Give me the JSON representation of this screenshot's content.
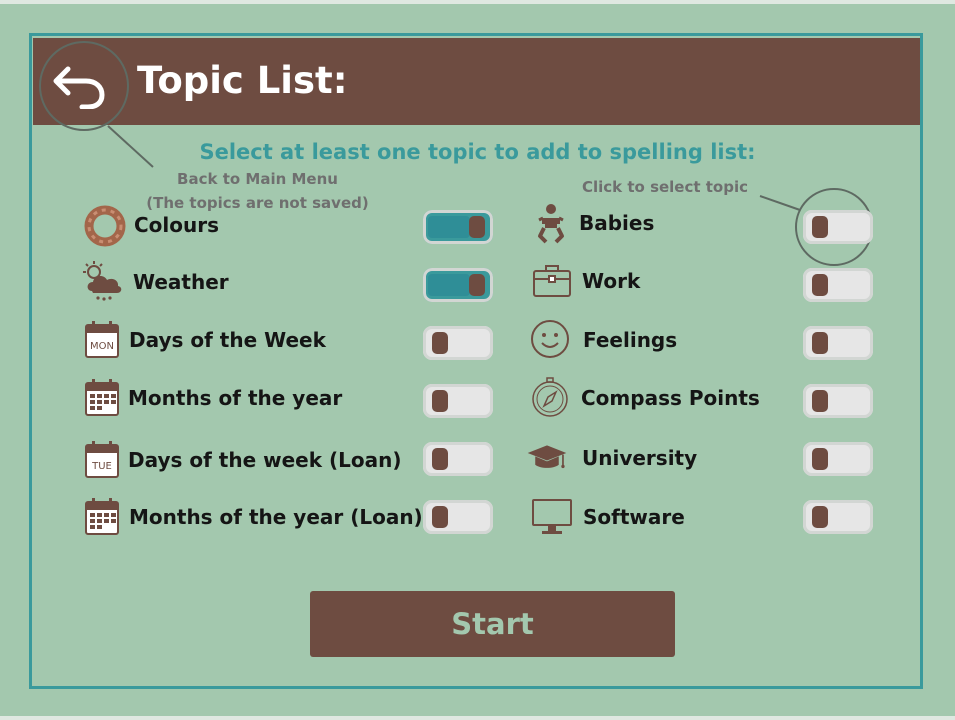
{
  "header": {
    "title": "Topic List:"
  },
  "instruction": "Select at least one topic to add to spelling list:",
  "notes": {
    "back_line1": "Back to Main Menu",
    "back_line2": "(The topics are not saved)",
    "click_hint": "Click to select topic"
  },
  "topics_left": [
    {
      "label": "Colours",
      "icon": "colours-ring-icon",
      "selected": true
    },
    {
      "label": "Weather",
      "icon": "weather-cloud-icon",
      "selected": true
    },
    {
      "label": "Days of the Week",
      "icon": "calendar-mon-icon",
      "icon_text": "MON",
      "selected": false
    },
    {
      "label": "Months of the year",
      "icon": "calendar-grid-icon",
      "selected": false
    },
    {
      "label": "Days of the week (Loan)",
      "icon": "calendar-tue-icon",
      "icon_text": "TUE",
      "selected": false
    },
    {
      "label": "Months of the year (Loan)",
      "icon": "calendar-grid-icon",
      "selected": false
    }
  ],
  "topics_right": [
    {
      "label": "Babies",
      "icon": "baby-icon",
      "selected": false
    },
    {
      "label": "Work",
      "icon": "briefcase-icon",
      "selected": false
    },
    {
      "label": "Feelings",
      "icon": "smiley-icon",
      "selected": false
    },
    {
      "label": "Compass Points",
      "icon": "compass-icon",
      "selected": false
    },
    {
      "label": "University",
      "icon": "graduation-cap-icon",
      "selected": false
    },
    {
      "label": "Software",
      "icon": "monitor-icon",
      "selected": false
    }
  ],
  "start_label": "Start",
  "colors": {
    "background": "#a3c8ae",
    "brown": "#6e4c41",
    "teal": "#3a9a9c",
    "toggle_off": "#e6e6e6"
  }
}
